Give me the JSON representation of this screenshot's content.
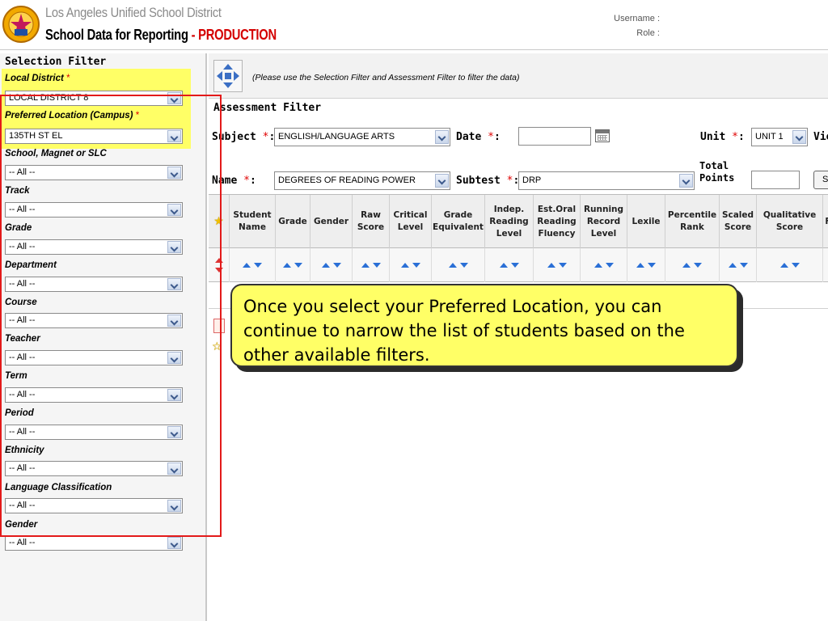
{
  "header": {
    "district": "Los Angeles Unified School District",
    "app_title": "School Data for Reporting",
    "env_sep": " - ",
    "environment": "PRODUCTION",
    "username_label": "Username :",
    "role_label": "Role :"
  },
  "selection_filter": {
    "title": "Selection Filter",
    "required_mark": "*",
    "fields": [
      {
        "label": "Local District",
        "required": true,
        "value": "LOCAL DISTRICT 8"
      },
      {
        "label": "Preferred Location (Campus)",
        "required": true,
        "value": "135TH ST EL"
      },
      {
        "label": "School, Magnet or SLC",
        "value": "-- All --"
      },
      {
        "label": "Track",
        "value": "-- All --"
      },
      {
        "label": "Grade",
        "value": "-- All --"
      },
      {
        "label": "Department",
        "value": "-- All --"
      },
      {
        "label": "Course",
        "value": "-- All --"
      },
      {
        "label": "Teacher",
        "value": "-- All --"
      },
      {
        "label": "Term",
        "value": "-- All --"
      },
      {
        "label": "Period",
        "value": "-- All --"
      },
      {
        "label": "Ethnicity",
        "value": "-- All --"
      },
      {
        "label": "Language Classification",
        "value": "-- All --"
      },
      {
        "label": "Gender",
        "value": "-- All --"
      }
    ]
  },
  "toolbar": {
    "hint": "(Please use the Selection Filter and Assessment Filter to filter the data)"
  },
  "assessment_filter": {
    "title": "Assessment Filter",
    "subject_label": "Subject",
    "subject_value": "ENGLISH/LANGUAGE ARTS",
    "date_label": "Date",
    "date_value": "",
    "unit_label": "Unit",
    "unit_value": "UNIT 1",
    "view_label": "Vie",
    "name_label": "Name",
    "name_value": "DEGREES OF READING POWER",
    "subtest_label": "Subtest",
    "subtest_value": "DRP",
    "total_points_label": "Total Points",
    "total_points_value": "",
    "search_button": "S",
    "colon": ":",
    "required_mark": "*"
  },
  "grid": {
    "columns": [
      "Student Name",
      "Grade",
      "Gender",
      "Raw Score",
      "Critical Level",
      "Grade Equivalent",
      "Indep. Reading Level",
      "Est.Oral Reading Fluency",
      "Running Record Level",
      "Lexile",
      "Percentile Rank",
      "Scaled Score",
      "Qualitative Score",
      "F"
    ]
  },
  "callout": {
    "text": "Once you select your Preferred Location, you can continue to narrow the list of students based on the other available filters."
  },
  "colors": {
    "highlight": "#ffff66",
    "annotation_red": "#e31a1a",
    "production_red": "#d40000",
    "sort_blue": "#2a6fd6"
  },
  "icons": {
    "logo": "lausd-seal-icon",
    "nav": "navigation-arrows-icon",
    "calendar": "calendar-icon",
    "favorite": "star-icon"
  }
}
